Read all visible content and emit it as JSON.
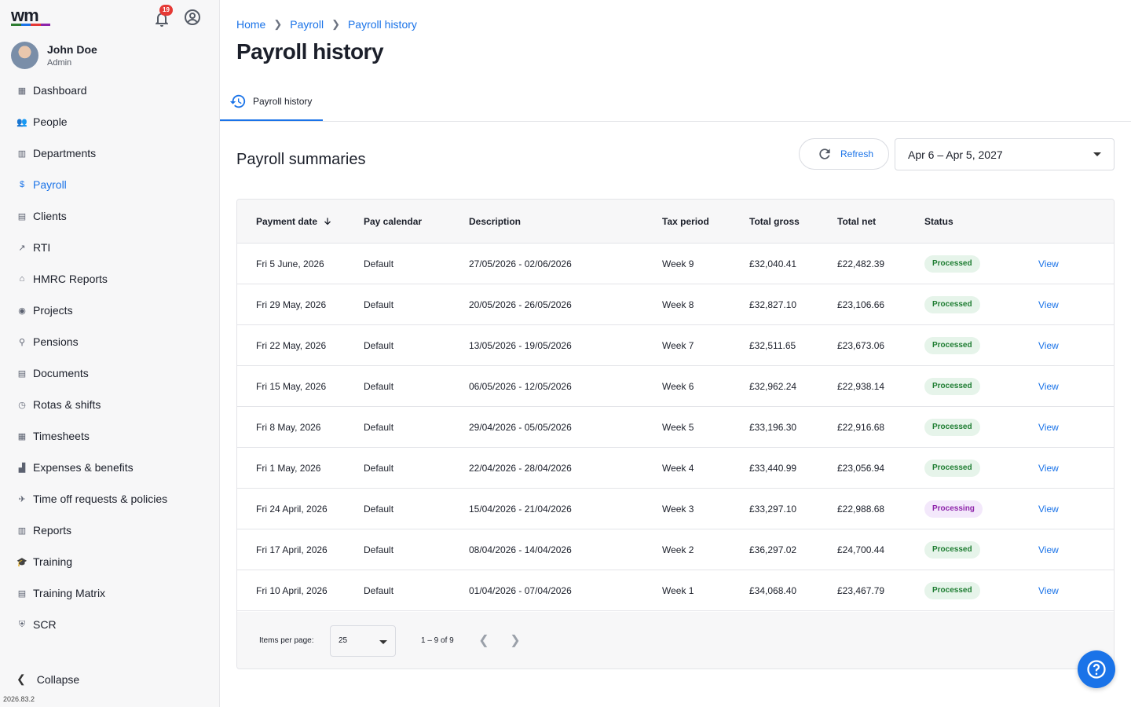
{
  "app": {
    "logo_text": "wm",
    "logo_colors": [
      "#2e7d32",
      "#1a73e8",
      "#e53935",
      "#8e24aa"
    ],
    "notification_count": "19",
    "version": "2026.83.2"
  },
  "user": {
    "name": "John Doe",
    "role": "Admin"
  },
  "sidebar": {
    "items": [
      {
        "label": "Dashboard",
        "icon": "dashboard-icon",
        "glyph": "▦"
      },
      {
        "label": "People",
        "icon": "people-icon",
        "glyph": "👥"
      },
      {
        "label": "Departments",
        "icon": "building-icon",
        "glyph": "▥"
      },
      {
        "label": "Payroll",
        "icon": "dollar-icon",
        "glyph": "$",
        "active": true
      },
      {
        "label": "Clients",
        "icon": "clients-icon",
        "glyph": "▤"
      },
      {
        "label": "RTI",
        "icon": "trend-icon",
        "glyph": "↗"
      },
      {
        "label": "HMRC Reports",
        "icon": "bank-icon",
        "glyph": "⌂"
      },
      {
        "label": "Projects",
        "icon": "projects-icon",
        "glyph": "◉"
      },
      {
        "label": "Pensions",
        "icon": "elderly-icon",
        "glyph": "⚲"
      },
      {
        "label": "Documents",
        "icon": "document-icon",
        "glyph": "▤"
      },
      {
        "label": "Rotas & shifts",
        "icon": "clock-icon",
        "glyph": "◷"
      },
      {
        "label": "Timesheets",
        "icon": "calendar-icon",
        "glyph": "▦"
      },
      {
        "label": "Expenses & benefits",
        "icon": "receipt-icon",
        "glyph": "▟"
      },
      {
        "label": "Time off requests & policies",
        "icon": "flight-icon",
        "glyph": "✈"
      },
      {
        "label": "Reports",
        "icon": "reports-icon",
        "glyph": "▥"
      },
      {
        "label": "Training",
        "icon": "school-icon",
        "glyph": "🎓"
      },
      {
        "label": "Training Matrix",
        "icon": "matrix-icon",
        "glyph": "▤"
      },
      {
        "label": "SCR",
        "icon": "shield-icon",
        "glyph": "⛨"
      }
    ],
    "collapse_label": "Collapse"
  },
  "breadcrumb": [
    "Home",
    "Payroll",
    "Payroll history"
  ],
  "page": {
    "title": "Payroll history",
    "tab_label": "Payroll history",
    "section_title": "Payroll summaries",
    "refresh_label": "Refresh",
    "date_range": "Apr 6 – Apr 5, 2027"
  },
  "table": {
    "headers": [
      "Payment date",
      "Pay calendar",
      "Description",
      "Tax period",
      "Total gross",
      "Total net",
      "Status"
    ],
    "view_label": "View",
    "rows": [
      {
        "date": "Fri 5 June, 2026",
        "calendar": "Default",
        "desc": "27/05/2026 - 02/06/2026",
        "period": "Week 9",
        "gross": "£32,040.41",
        "net": "£22,482.39",
        "status": "Processed"
      },
      {
        "date": "Fri 29 May, 2026",
        "calendar": "Default",
        "desc": "20/05/2026 - 26/05/2026",
        "period": "Week 8",
        "gross": "£32,827.10",
        "net": "£23,106.66",
        "status": "Processed"
      },
      {
        "date": "Fri 22 May, 2026",
        "calendar": "Default",
        "desc": "13/05/2026 - 19/05/2026",
        "period": "Week 7",
        "gross": "£32,511.65",
        "net": "£23,673.06",
        "status": "Processed"
      },
      {
        "date": "Fri 15 May, 2026",
        "calendar": "Default",
        "desc": "06/05/2026 - 12/05/2026",
        "period": "Week 6",
        "gross": "£32,962.24",
        "net": "£22,938.14",
        "status": "Processed"
      },
      {
        "date": "Fri 8 May, 2026",
        "calendar": "Default",
        "desc": "29/04/2026 - 05/05/2026",
        "period": "Week 5",
        "gross": "£33,196.30",
        "net": "£22,916.68",
        "status": "Processed"
      },
      {
        "date": "Fri 1 May, 2026",
        "calendar": "Default",
        "desc": "22/04/2026 - 28/04/2026",
        "period": "Week 4",
        "gross": "£33,440.99",
        "net": "£23,056.94",
        "status": "Processed"
      },
      {
        "date": "Fri 24 April, 2026",
        "calendar": "Default",
        "desc": "15/04/2026 - 21/04/2026",
        "period": "Week 3",
        "gross": "£33,297.10",
        "net": "£22,988.68",
        "status": "Processing"
      },
      {
        "date": "Fri 17 April, 2026",
        "calendar": "Default",
        "desc": "08/04/2026 - 14/04/2026",
        "period": "Week 2",
        "gross": "£36,297.02",
        "net": "£24,700.44",
        "status": "Processed"
      },
      {
        "date": "Fri 10 April, 2026",
        "calendar": "Default",
        "desc": "01/04/2026 - 07/04/2026",
        "period": "Week 1",
        "gross": "£34,068.40",
        "net": "£23,467.79",
        "status": "Processed"
      }
    ]
  },
  "pagination": {
    "items_per_page_label": "Items per page:",
    "items_per_page_value": "25",
    "range_label": "1 – 9 of 9"
  },
  "colors": {
    "accent": "#1a73e8",
    "processed_bg": "#e6f4ea",
    "processed_fg": "#1e7d32",
    "processing_bg": "#f3e8fb",
    "processing_fg": "#8e24aa"
  }
}
